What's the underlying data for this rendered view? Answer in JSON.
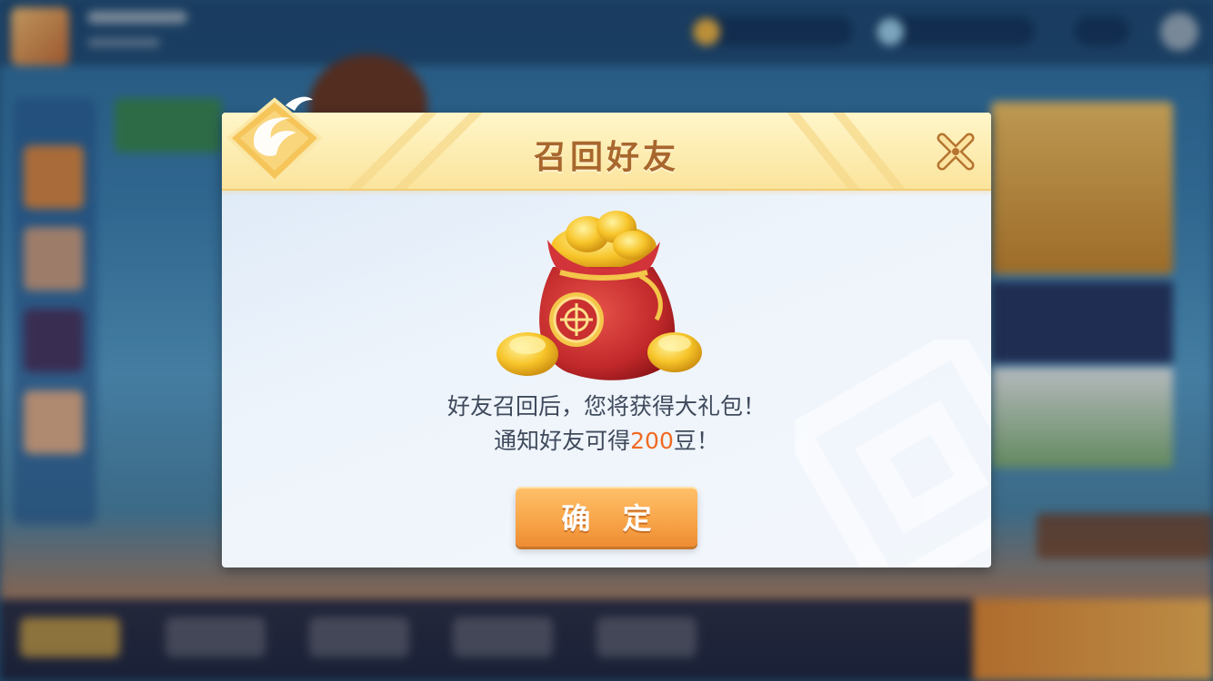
{
  "dialog": {
    "title": "召回好友",
    "message_line1": "好友召回后，您将获得大礼包！",
    "message_line2_prefix": "通知好友可得",
    "message_line2_amount": "200",
    "message_line2_suffix": "豆！",
    "confirm_label": "确 定"
  },
  "icons": {
    "close": "close-icon",
    "logo": "phoenix-logo-icon",
    "reward": "gold-ingot-bag-icon"
  },
  "colors": {
    "title": "#a8672d",
    "highlight": "#f06a22",
    "button": "#f8a64a",
    "header": "#fbe49c"
  }
}
